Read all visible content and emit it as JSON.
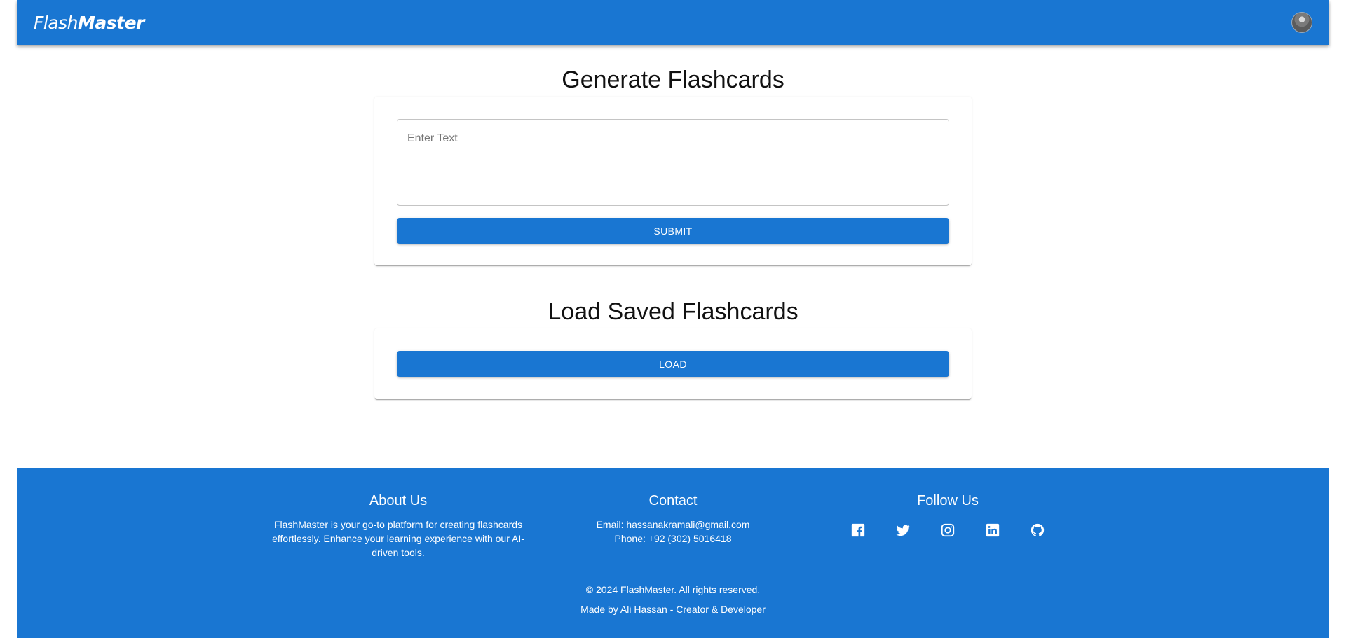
{
  "header": {
    "brand_part1": "Flash",
    "brand_part2": "Master",
    "avatar_alt": "User avatar"
  },
  "generate": {
    "title": "Generate Flashcards",
    "input_placeholder": "Enter Text",
    "input_value": "",
    "submit_label": "Submit"
  },
  "load": {
    "title": "Load Saved Flashcards",
    "load_label": "Load"
  },
  "footer": {
    "about": {
      "heading": "About Us",
      "text": "FlashMaster is your go-to platform for creating flashcards effortlessly. Enhance your learning experience with our AI-driven tools."
    },
    "contact": {
      "heading": "Contact",
      "email": "Email: hassanakramali@gmail.com",
      "phone": "Phone: +92 (302) 5016418"
    },
    "follow": {
      "heading": "Follow Us",
      "icons": [
        "facebook-icon",
        "twitter-icon",
        "instagram-icon",
        "linkedin-icon",
        "github-icon"
      ]
    },
    "copyright": "© 2024 FlashMaster. All rights reserved.",
    "credit": "Made by Ali Hassan - Creator & Developer"
  },
  "colors": {
    "primary": "#1976d2",
    "background": "#ffffff",
    "text": "#111111"
  }
}
